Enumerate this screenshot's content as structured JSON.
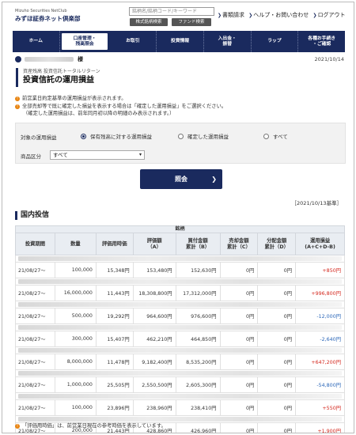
{
  "header": {
    "logo_en": "Mizuho Securities NetClub",
    "logo_jp": "みずほ証券ネット倶楽部",
    "search_placeholder": "銘柄名/銘柄コード/キーワード",
    "stock_search": "株式銘柄検索",
    "fund_search": "ファンド検索",
    "links": [
      "書類請求",
      "ヘルプ・お問い合わせ",
      "ログアウト"
    ]
  },
  "nav": [
    "ホーム",
    "口座管理・\n残高照会",
    "お取引",
    "投資情報",
    "入出金・\n振替",
    "ラップ",
    "各種お手続き\n・ご確認"
  ],
  "user": {
    "sama": "様",
    "date": "2021/10/14"
  },
  "title": {
    "breadcrumb": "資産残高 投資信託トータルリターン",
    "heading": "投資信託の運用損益"
  },
  "notes": {
    "n1": "前営業日約定基準の運用損益が表示されます。",
    "n2": "全部売却等で既に確定した損益を表示する場合は「確定した運用損益」をご選択ください。",
    "n3": "（確定した運用損益は、前年同月初以降の明細のみ表示されます。）"
  },
  "filter": {
    "label_target": "対象の運用損益",
    "radios": [
      "保有残高に対する運用損益",
      "確定した運用損益",
      "すべて"
    ],
    "label_category": "商品区分",
    "category_value": "すべて"
  },
  "submit_label": "照会",
  "base_date": "［2021/10/13基準］",
  "section_title": "国内投信",
  "table": {
    "group_header": "銘柄",
    "headers": [
      "投資期間",
      "数量",
      "評価用時価",
      "評価額\n（A）",
      "買付金額\n累計（B）",
      "売却金額\n累計（C）",
      "分配金額\n累計（D）",
      "運用損益\n(A+C+D-B)"
    ],
    "rows": [
      {
        "period": "21/08/27〜",
        "qty": "100,000",
        "price": "15,348円",
        "val": "153,480円",
        "buy": "152,630円",
        "sell": "0円",
        "dist": "0円",
        "pl": "+850円",
        "sign": "pos"
      },
      {
        "period": "21/08/27〜",
        "qty": "16,000,000",
        "price": "11,443円",
        "val": "18,308,800円",
        "buy": "17,312,000円",
        "sell": "0円",
        "dist": "0円",
        "pl": "+996,800円",
        "sign": "pos"
      },
      {
        "period": "21/08/27〜",
        "qty": "500,000",
        "price": "19,292円",
        "val": "964,600円",
        "buy": "976,600円",
        "sell": "0円",
        "dist": "0円",
        "pl": "-12,000円",
        "sign": "neg"
      },
      {
        "period": "21/08/27〜",
        "qty": "300,000",
        "price": "15,407円",
        "val": "462,210円",
        "buy": "464,850円",
        "sell": "0円",
        "dist": "0円",
        "pl": "-2,640円",
        "sign": "neg"
      },
      {
        "period": "21/08/27〜",
        "qty": "8,000,000",
        "price": "11,478円",
        "val": "9,182,400円",
        "buy": "8,535,200円",
        "sell": "0円",
        "dist": "0円",
        "pl": "+647,200円",
        "sign": "pos"
      },
      {
        "period": "21/08/27〜",
        "qty": "1,000,000",
        "price": "25,505円",
        "val": "2,550,500円",
        "buy": "2,605,300円",
        "sell": "0円",
        "dist": "0円",
        "pl": "-54,800円",
        "sign": "neg"
      },
      {
        "period": "21/08/27〜",
        "qty": "100,000",
        "price": "23,896円",
        "val": "238,960円",
        "buy": "238,410円",
        "sell": "0円",
        "dist": "0円",
        "pl": "+550円",
        "sign": "pos"
      },
      {
        "period": "21/08/27〜",
        "qty": "200,000",
        "price": "21,443円",
        "val": "428,860円",
        "buy": "426,960円",
        "sell": "0円",
        "dist": "0円",
        "pl": "+1,900円",
        "sign": "pos"
      }
    ]
  },
  "footnote": "「評価用時価」は、前営業日現在の参考時価を表示しています。",
  "colors": {
    "navy": "#1a2a5e",
    "positive": "#d4261c",
    "negative": "#2a66b8",
    "note_icon": "#e8830f"
  }
}
